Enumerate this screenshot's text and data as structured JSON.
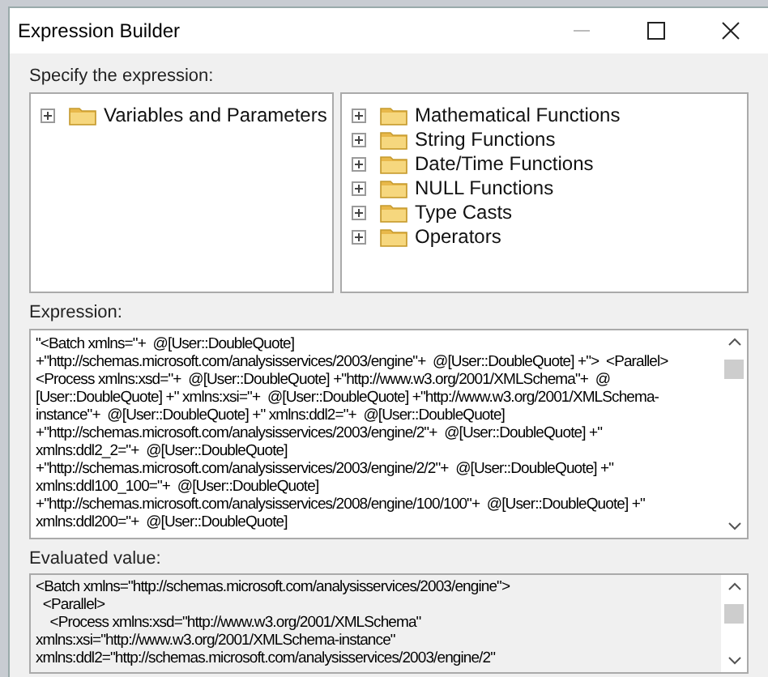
{
  "window": {
    "title": "Expression Builder"
  },
  "specify_label": "Specify the expression:",
  "variables_tree": [
    {
      "label": "Variables and Parameters",
      "expanded": false
    }
  ],
  "functions_tree": [
    {
      "label": "Mathematical Functions",
      "expanded": false
    },
    {
      "label": "String Functions",
      "expanded": false
    },
    {
      "label": "Date/Time Functions",
      "expanded": false
    },
    {
      "label": "NULL Functions",
      "expanded": false
    },
    {
      "label": "Type Casts",
      "expanded": false
    },
    {
      "label": "Operators",
      "expanded": false
    }
  ],
  "expression": {
    "label": "Expression:",
    "lines": [
      "\"<Batch xmlns=\"+  @[User::DoubleQuote]",
      "+\"http://schemas.microsoft.com/analysisservices/2003/engine\"+  @[User::DoubleQuote] +\">  <Parallel>",
      "<Process xmlns:xsd=\"+  @[User::DoubleQuote] +\"http://www.w3.org/2001/XMLSchema\"+  @",
      "[User::DoubleQuote] +\" xmlns:xsi=\"+  @[User::DoubleQuote] +\"http://www.w3.org/2001/XMLSchema-",
      "instance\"+  @[User::DoubleQuote] +\" xmlns:ddl2=\"+  @[User::DoubleQuote]",
      "+\"http://schemas.microsoft.com/analysisservices/2003/engine/2\"+  @[User::DoubleQuote] +\"",
      "xmlns:ddl2_2=\"+  @[User::DoubleQuote]",
      "+\"http://schemas.microsoft.com/analysisservices/2003/engine/2/2\"+  @[User::DoubleQuote] +\"",
      "xmlns:ddl100_100=\"+  @[User::DoubleQuote]",
      "+\"http://schemas.microsoft.com/analysisservices/2008/engine/100/100\"+  @[User::DoubleQuote] +\"",
      "xmlns:ddl200=\"+  @[User::DoubleQuote]"
    ]
  },
  "evaluated": {
    "label": "Evaluated value:",
    "lines": [
      "<Batch xmlns=\"http://schemas.microsoft.com/analysisservices/2003/engine\">",
      "  <Parallel>",
      "    <Process xmlns:xsd=\"http://www.w3.org/2001/XMLSchema\"",
      "xmlns:xsi=\"http://www.w3.org/2001/XMLSchema-instance\"",
      "xmlns:ddl2=\"http://schemas.microsoft.com/analysisservices/2003/engine/2\""
    ]
  }
}
